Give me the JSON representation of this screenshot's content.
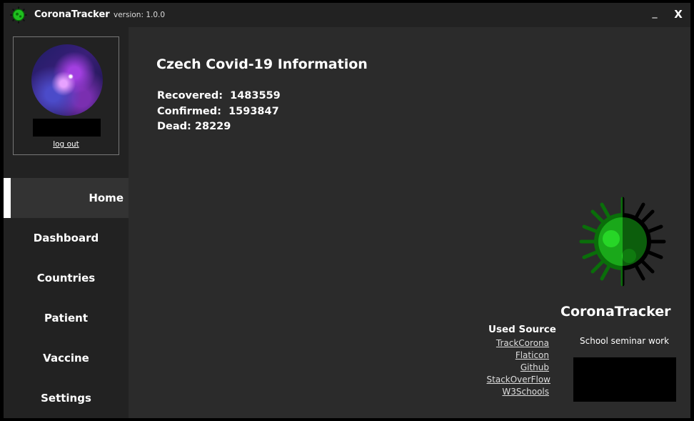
{
  "titlebar": {
    "app_title": "CoronaTracker",
    "version": "version: 1.0.0",
    "minimize_label": "_",
    "close_label": "X"
  },
  "profile": {
    "logout_label": "log out"
  },
  "sidebar": {
    "items": [
      {
        "label": "Home",
        "active": true
      },
      {
        "label": "Dashboard"
      },
      {
        "label": "Countries"
      },
      {
        "label": "Patient"
      },
      {
        "label": "Vaccine"
      },
      {
        "label": "Settings"
      }
    ]
  },
  "main": {
    "title": "Czech Covid-19 Information",
    "stats": [
      {
        "label": "Recovered:",
        "value": "1483559"
      },
      {
        "label": "Confirmed:",
        "value": "1593847"
      },
      {
        "label": "Dead:",
        "value": "28229"
      }
    ]
  },
  "brand": {
    "name": "CoronaTracker",
    "subtitle": "School seminar work",
    "icon": "virus-icon"
  },
  "sources": {
    "title": "Used Source",
    "links": [
      "TrackCorona",
      "Flaticon",
      "Github",
      "StackOverFlow",
      "W3Schools"
    ]
  },
  "colors": {
    "virus_green": "#1fbf1f",
    "virus_dark_green": "#0a6e0a",
    "sidebar_bg": "#222222",
    "content_bg": "#2b2b2b"
  }
}
